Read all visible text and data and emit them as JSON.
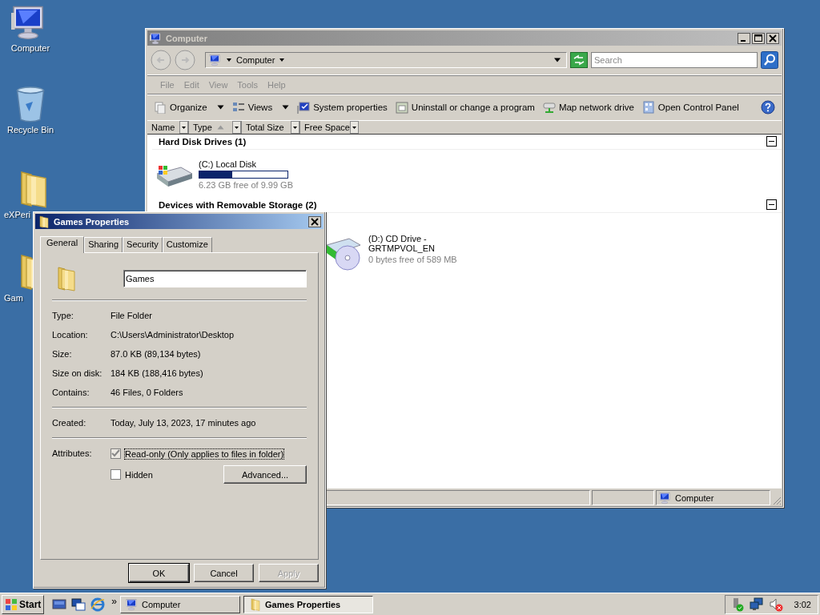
{
  "desktop_icons": [
    {
      "label": "Computer",
      "kind": "computer"
    },
    {
      "label": "Recycle Bin",
      "kind": "recycle"
    },
    {
      "label": "eXPeri",
      "kind": "folder"
    },
    {
      "label": "Gam",
      "kind": "folder"
    }
  ],
  "explorer": {
    "title": "Computer",
    "address": "Computer",
    "search_placeholder": "Search",
    "menu": [
      "File",
      "Edit",
      "View",
      "Tools",
      "Help"
    ],
    "toolbar": [
      {
        "label": "Organize",
        "kind": "organize"
      },
      {
        "label": "Views",
        "kind": "views"
      },
      {
        "label": "System properties",
        "kind": "system"
      },
      {
        "label": "Uninstall or change a program",
        "kind": "uninstall"
      },
      {
        "label": "Map network drive",
        "kind": "network"
      },
      {
        "label": "Open Control Panel",
        "kind": "control"
      }
    ],
    "columns": [
      {
        "label": "Name",
        "sorted": false
      },
      {
        "label": "Type",
        "sorted": true
      },
      {
        "label": "Total Size",
        "sorted": false
      },
      {
        "label": "Free Space",
        "sorted": false
      }
    ],
    "groups": [
      {
        "title": "Hard Disk Drives (1)",
        "expanded": true,
        "items": [
          {
            "name": "(C:) Local Disk",
            "kind": "hdd",
            "level": 0.376,
            "detail": "6.23 GB free of 9.99 GB"
          }
        ]
      },
      {
        "title": "Devices with Removable Storage (2)",
        "expanded": true,
        "items": [
          {
            "name": "(D:) CD Drive - GRTMPVOL_EN",
            "kind": "cd",
            "detail": "0 bytes free of 589 MB"
          }
        ]
      }
    ],
    "status": "Computer"
  },
  "dialog": {
    "title": "Games Properties",
    "tabs": [
      {
        "label": "General",
        "selected": true
      },
      {
        "label": "Sharing",
        "selected": false
      },
      {
        "label": "Security",
        "selected": false
      },
      {
        "label": "Customize",
        "selected": false
      }
    ],
    "name_value": "Games",
    "sections": [
      [
        {
          "label": "Type:",
          "value": "File Folder"
        },
        {
          "label": "Location:",
          "value": "C:\\Users\\Administrator\\Desktop"
        },
        {
          "label": "Size:",
          "value": "87.0 KB (89,134 bytes)"
        },
        {
          "label": "Size on disk:",
          "value": "184 KB (188,416 bytes)"
        },
        {
          "label": "Contains:",
          "value": "46 Files, 0 Folders"
        }
      ],
      [
        {
          "label": "Created:",
          "value": "Today, July 13, 2023, 17 minutes ago"
        }
      ]
    ],
    "attributes_label": "Attributes:",
    "attributes": [
      {
        "label": "Read-only (Only applies to files in folder)",
        "checked": true
      },
      {
        "label": "Hidden",
        "checked": false
      }
    ],
    "advanced_button": "Advanced...",
    "buttons": [
      {
        "label": "OK",
        "disabled": false
      },
      {
        "label": "Cancel",
        "disabled": false
      },
      {
        "label": "Apply",
        "disabled": true
      }
    ]
  },
  "taskbar": {
    "start": "Start",
    "quick_launch": [
      {
        "kind": "desktop"
      },
      {
        "kind": "switch"
      },
      {
        "kind": "browser"
      }
    ],
    "chevron": "»",
    "tasks": [
      {
        "label": "Computer",
        "kind": "computer",
        "selected": false
      },
      {
        "label": "Games Properties",
        "kind": "folder",
        "selected": true
      }
    ],
    "clock": "3:02"
  }
}
